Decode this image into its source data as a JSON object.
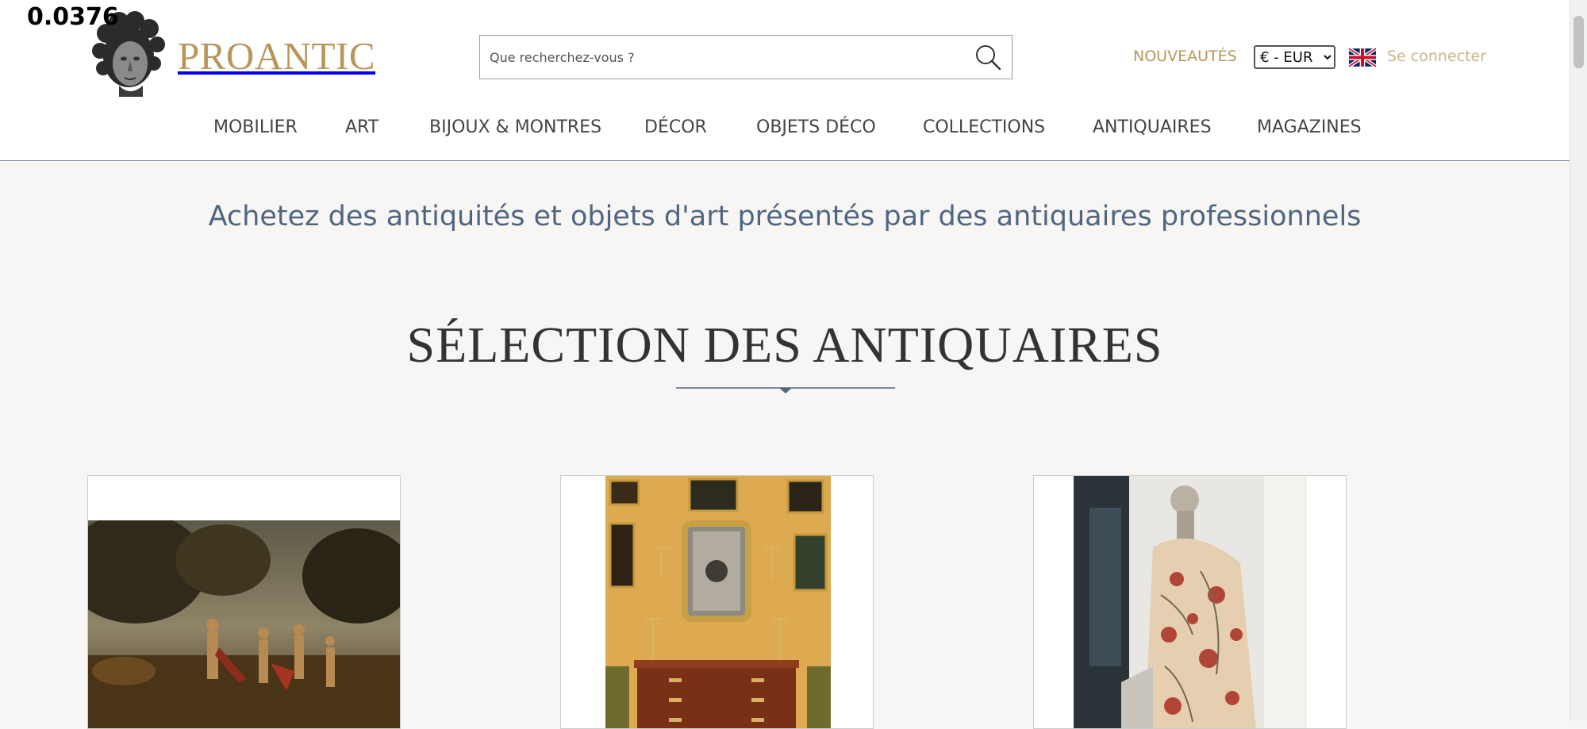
{
  "debug_value": "0.0376",
  "brand": {
    "name": "PROANTIC"
  },
  "search": {
    "placeholder": "Que recherchez-vous ?"
  },
  "header": {
    "new_link": "NOUVEAUTÉS",
    "currency": {
      "selected": "€ - EUR"
    },
    "language_flag": "uk-flag-icon",
    "login": "Se connecter"
  },
  "nav": {
    "items": [
      {
        "label": "MOBILIER"
      },
      {
        "label": "ART"
      },
      {
        "label": "BIJOUX & MONTRES"
      },
      {
        "label": "DÉCOR"
      },
      {
        "label": "OBJETS DÉCO"
      },
      {
        "label": "COLLECTIONS"
      },
      {
        "label": "ANTIQUAIRES"
      },
      {
        "label": "MAGAZINES"
      }
    ]
  },
  "main": {
    "tagline": "Achetez des antiquités et objets d'art présentés par des antiquaires professionnels",
    "section_title": "SÉLECTION DES ANTIQUAIRES"
  },
  "colors": {
    "accent_gold": "#b8965b",
    "nav_text": "#444444",
    "tagline_blue": "#506680",
    "page_background": "#f7f6f4"
  }
}
